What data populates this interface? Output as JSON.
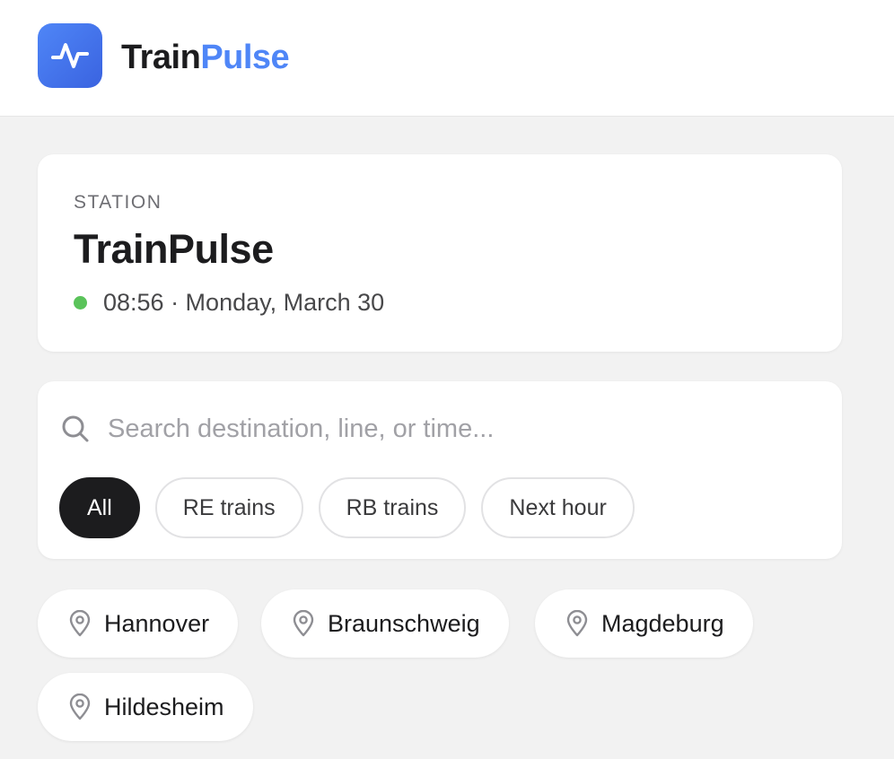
{
  "header": {
    "brand_part1": "Train",
    "brand_part2": "Pulse",
    "logo_icon": "activity-pulse-icon",
    "accent_color": "#4f86f7"
  },
  "station": {
    "label": "STATION",
    "name": "TrainPulse",
    "datetime": "08:56 · Monday, March 30",
    "live_indicator_color": "#5ac35a"
  },
  "search": {
    "icon": "search-icon",
    "placeholder": "Search destination, line, or time...",
    "value": ""
  },
  "filters": [
    {
      "label": "All",
      "active": true
    },
    {
      "label": "RE trains",
      "active": false
    },
    {
      "label": "RB trains",
      "active": false
    },
    {
      "label": "Next hour",
      "active": false
    }
  ],
  "destinations": [
    {
      "label": "Hannover",
      "icon": "map-pin-icon"
    },
    {
      "label": "Braunschweig",
      "icon": "map-pin-icon"
    },
    {
      "label": "Magdeburg",
      "icon": "map-pin-icon"
    },
    {
      "label": "Hildesheim",
      "icon": "map-pin-icon"
    }
  ]
}
